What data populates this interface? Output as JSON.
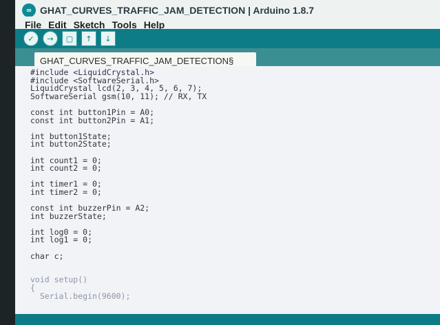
{
  "window": {
    "title": "GHAT_CURVES_TRAFFIC_JAM_DETECTION | Arduino 1.8.7"
  },
  "menu": {
    "items": [
      "File",
      "Edit",
      "Sketch",
      "Tools",
      "Help"
    ]
  },
  "toolbar": {
    "buttons": [
      {
        "name": "verify",
        "icon": "✓"
      },
      {
        "name": "upload",
        "icon": "→"
      },
      {
        "name": "new",
        "icon": "▢"
      },
      {
        "name": "open",
        "icon": "↑"
      },
      {
        "name": "save",
        "icon": "↓"
      }
    ]
  },
  "tabs": {
    "active_label": "GHAT_CURVES_TRAFFIC_JAM_DETECTION§"
  },
  "editor": {
    "lines": [
      {
        "text": "#include <LiquidCrystal.h>",
        "dim": false
      },
      {
        "text": "#include <SoftwareSerial.h>",
        "dim": false
      },
      {
        "text": "LiquidCrystal lcd(2, 3, 4, 5, 6, 7);",
        "dim": false
      },
      {
        "text": "SoftwareSerial gsm(10, 11); // RX, TX",
        "dim": false
      },
      {
        "text": "",
        "dim": false
      },
      {
        "text": "const int button1Pin = A0;",
        "dim": false
      },
      {
        "text": "const int button2Pin = A1;",
        "dim": false
      },
      {
        "text": "",
        "dim": false
      },
      {
        "text": "int button1State;",
        "dim": false
      },
      {
        "text": "int button2State;",
        "dim": false
      },
      {
        "text": "",
        "dim": false
      },
      {
        "text": "int count1 = 0;",
        "dim": false
      },
      {
        "text": "int count2 = 0;",
        "dim": false
      },
      {
        "text": "",
        "dim": false
      },
      {
        "text": "int timer1 = 0;",
        "dim": false
      },
      {
        "text": "int timer2 = 0;",
        "dim": false
      },
      {
        "text": "",
        "dim": false
      },
      {
        "text": "const int buzzerPin = A2;",
        "dim": false
      },
      {
        "text": "int buzzerState;",
        "dim": false
      },
      {
        "text": "",
        "dim": false
      },
      {
        "text": "int log0 = 0;",
        "dim": false
      },
      {
        "text": "int log1 = 0;",
        "dim": false
      },
      {
        "text": "",
        "dim": false
      },
      {
        "text": "char c;",
        "dim": false
      },
      {
        "text": "",
        "dim": false
      },
      {
        "text": "",
        "dim": false
      },
      {
        "text": "void setup()",
        "dim": true
      },
      {
        "text": "{",
        "dim": true
      },
      {
        "text": "  Serial.begin(9600);",
        "dim": true
      }
    ]
  }
}
